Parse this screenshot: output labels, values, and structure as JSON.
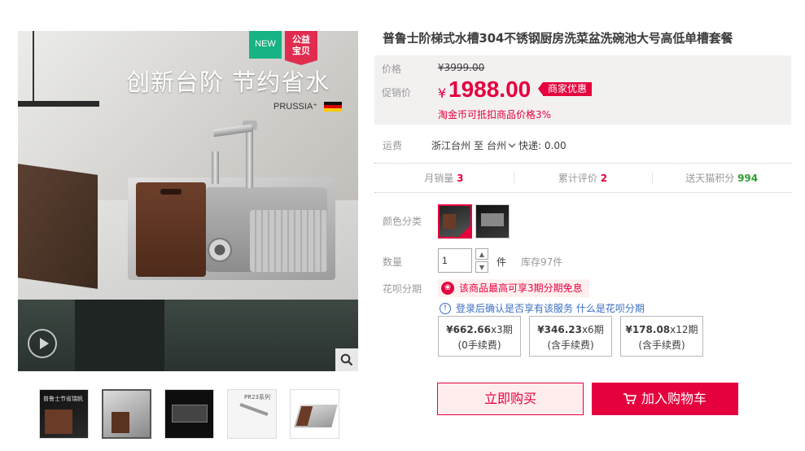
{
  "gallery": {
    "headline": "创新台阶 节约省水",
    "brand": "PRUSSIA⁺",
    "badge_new": "NEW",
    "badge_public": [
      "公益",
      "宝贝"
    ],
    "thumb1_text": "普鲁士节省瑞帆",
    "thumb4_text": "PR23系列"
  },
  "product": {
    "title": "普鲁士阶梯式水槽304不锈钢厨房洗菜盆洗碗池大号高低单槽套餐"
  },
  "price": {
    "original_label": "价格",
    "original": "¥3999.00",
    "promo_label": "促销价",
    "currency": "¥",
    "promo_price": "1988.00",
    "promo_tag": "商家优惠",
    "coin_note": "淘金币可抵扣商品价格3%"
  },
  "shipping": {
    "label": "运费",
    "from": "浙江台州",
    "to_word": "至",
    "destination": "台州",
    "method": "快递: 0.00"
  },
  "stats": [
    {
      "label": "月销量",
      "value": "3"
    },
    {
      "label": "累计评价",
      "value": "2"
    },
    {
      "label": "送天猫积分",
      "value": "994"
    }
  ],
  "options": {
    "color_label": "颜色分类",
    "qty_label": "数量",
    "qty_value": "1",
    "unit": "件",
    "stock": "库存97件"
  },
  "huabei": {
    "label": "花呗分期",
    "tip": "该商品最高可享3期分期免息",
    "info": "登录后确认是否享有该服务",
    "link": "什么是花呗分期",
    "plans": [
      {
        "amount": "¥662.66",
        "periods": "x3期",
        "fee": "(0手续费)"
      },
      {
        "amount": "¥346.23",
        "periods": "x6期",
        "fee": "(含手续费)"
      },
      {
        "amount": "¥178.08",
        "periods": "x12期",
        "fee": "(含手续费)"
      }
    ]
  },
  "actions": {
    "buy_now": "立即购买",
    "add_cart": "加入购物车"
  },
  "colors": {
    "accent": "#e5003e",
    "new_badge": "#18b384",
    "link": "#3c6ec3",
    "points": "#2e9e2e"
  }
}
